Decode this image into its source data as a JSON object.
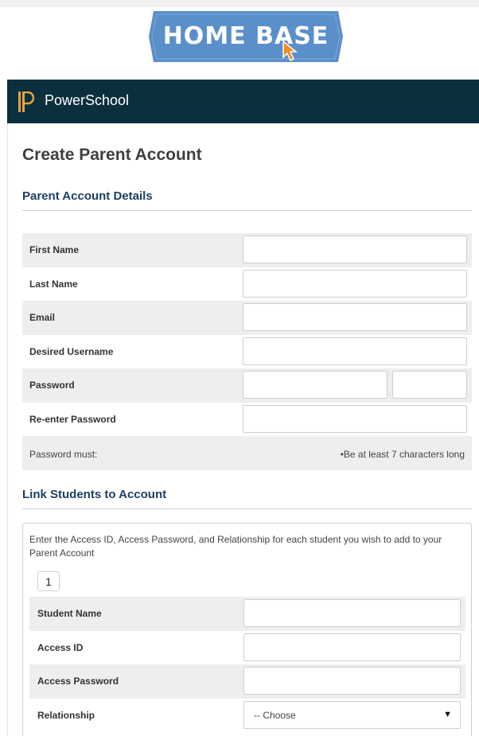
{
  "logo": {
    "text": "HOME BASE",
    "colors": {
      "badge": "#5b8fca",
      "cursor": "#f28b1e"
    },
    "icon": "cursor-arrow-icon"
  },
  "header": {
    "brand": "PowerSchool",
    "logo_icon": "powerschool-p-icon",
    "colors": {
      "bar": "#0c2f3d",
      "logo": "#e8a33c"
    }
  },
  "page": {
    "title": "Create Parent Account"
  },
  "parent_details": {
    "heading": "Parent Account Details",
    "fields": {
      "first_name": {
        "label": "First Name",
        "value": ""
      },
      "last_name": {
        "label": "Last Name",
        "value": ""
      },
      "email": {
        "label": "Email",
        "value": ""
      },
      "username": {
        "label": "Desired Username",
        "value": ""
      },
      "password": {
        "label": "Password",
        "value": ""
      },
      "password_confirm": {
        "label": "Re-enter Password",
        "value": ""
      }
    },
    "password_rules": {
      "label": "Password must:",
      "rule": "•Be at least 7 characters long"
    }
  },
  "link_students": {
    "heading": "Link Students to Account",
    "intro": "Enter the Access ID, Access Password, and Relationship for each student you wish to add to your Parent Account",
    "student_tab": "1",
    "fields": {
      "student_name": {
        "label": "Student Name",
        "value": ""
      },
      "access_id": {
        "label": "Access ID",
        "value": ""
      },
      "access_password": {
        "label": "Access Password",
        "value": ""
      },
      "relationship": {
        "label": "Relationship",
        "selected": "-- Choose",
        "icon": "caret-down-icon"
      }
    }
  },
  "colors": {
    "heading_blue": "#1d3f63",
    "row_shade": "#eeeeee",
    "border": "#cfcfcf"
  }
}
